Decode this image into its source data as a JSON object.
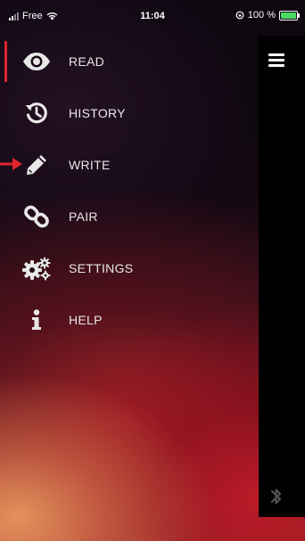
{
  "status_bar": {
    "carrier": "Free",
    "time": "11:04",
    "battery_percent": "100 %",
    "battery_level": 1.0,
    "battery_color": "#4cd964"
  },
  "menu": {
    "items": [
      {
        "key": "read",
        "label": "READ",
        "icon": "eye-icon",
        "active": true
      },
      {
        "key": "history",
        "label": "HISTORY",
        "icon": "history-icon",
        "active": false
      },
      {
        "key": "write",
        "label": "WRITE",
        "icon": "pencil-icon",
        "active": false
      },
      {
        "key": "pair",
        "label": "PAIR",
        "icon": "link-icon",
        "active": false
      },
      {
        "key": "settings",
        "label": "SETTINGS",
        "icon": "gears-icon",
        "active": false
      },
      {
        "key": "help",
        "label": "HELP",
        "icon": "info-icon",
        "active": false
      }
    ]
  },
  "main_panel": {
    "menu_icon": "hamburger-icon",
    "status_icon": "bluetooth-icon"
  },
  "annotation": {
    "icon": "red-arrow-icon",
    "color": "#e0262f"
  },
  "colors": {
    "accent": "#e0262f",
    "text": "#e8e8e8"
  }
}
